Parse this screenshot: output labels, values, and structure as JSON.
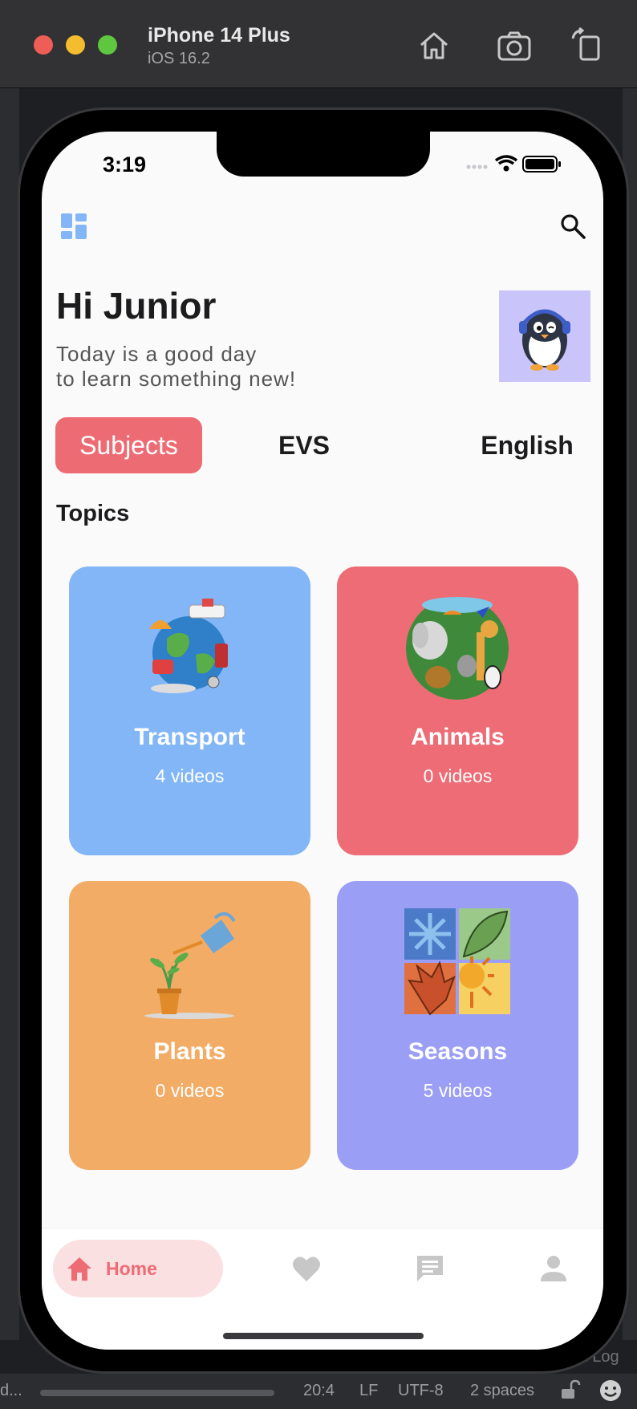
{
  "simulator": {
    "device_name": "iPhone 14 Plus",
    "os_version": "iOS 16.2"
  },
  "status_bar": {
    "time": "3:19"
  },
  "header": {
    "greeting": "Hi Junior",
    "subtitle_line1": "Today is a good day",
    "subtitle_line2": "to learn something new!"
  },
  "tabs": [
    {
      "label": "Subjects",
      "active": true
    },
    {
      "label": "EVS",
      "active": false
    },
    {
      "label": "English",
      "active": false
    }
  ],
  "section_title": "Topics",
  "topics": [
    {
      "title": "Transport",
      "count": "4 videos",
      "color": "#82b6f6"
    },
    {
      "title": "Animals",
      "count": "0 videos",
      "color": "#ed6c75"
    },
    {
      "title": "Plants",
      "count": "0 videos",
      "color": "#f2ac66"
    },
    {
      "title": "Seasons",
      "count": "5 videos",
      "color": "#9b9ef5"
    }
  ],
  "bottom_nav": {
    "home_label": "Home",
    "items": [
      "home-icon",
      "heart-icon",
      "chat-icon",
      "person-icon"
    ]
  },
  "ide_status": {
    "left_text": "d...",
    "position": "20:4",
    "line_ending": "LF",
    "encoding": "UTF-8",
    "indent": "2 spaces",
    "panel_label": "nt Log"
  },
  "colors": {
    "accent": "#ed6b73",
    "tab_active_bg": "#ed6b73",
    "nav_home_bg": "#fbe0e2"
  }
}
